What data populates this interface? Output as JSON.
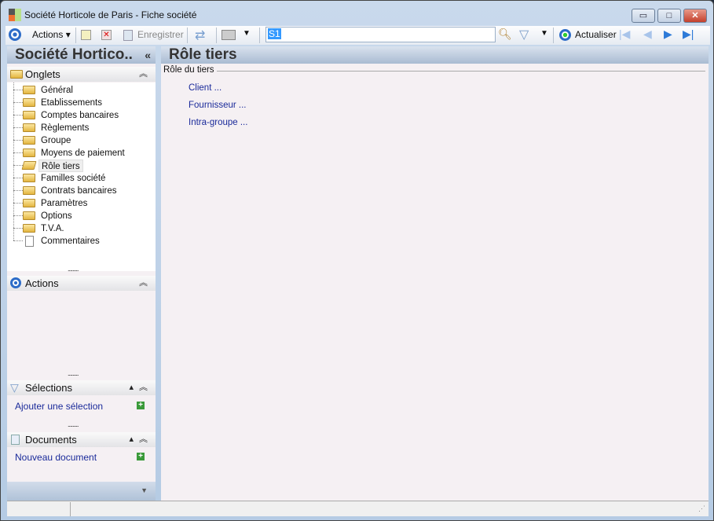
{
  "window": {
    "title": "Société Horticole de Paris -  Fiche société",
    "minimize": "▭",
    "maximize": "□",
    "close": "✕"
  },
  "toolbar": {
    "actions": "Actions",
    "save": "Enregistrer",
    "search_value": "S1",
    "refresh": "Actualiser"
  },
  "left": {
    "title": "Société Hortico..",
    "collapse": "«",
    "onglets": {
      "label": "Onglets",
      "items": [
        "Général",
        "Etablissements",
        "Comptes bancaires",
        "Règlements",
        "Groupe",
        "Moyens de paiement",
        "Rôle tiers",
        "Familles société",
        "Contrats bancaires",
        "Paramètres",
        "Options",
        "T.V.A.",
        "Commentaires"
      ]
    },
    "actions": {
      "label": "Actions"
    },
    "selections": {
      "label": "Sélections",
      "link": "Ajouter une sélection"
    },
    "documents": {
      "label": "Documents",
      "link": "Nouveau document"
    }
  },
  "main": {
    "title": "Rôle tiers",
    "group": "Rôle du tiers",
    "links": [
      "Client ...",
      "Fournisseur ...",
      "Intra-groupe ..."
    ]
  }
}
